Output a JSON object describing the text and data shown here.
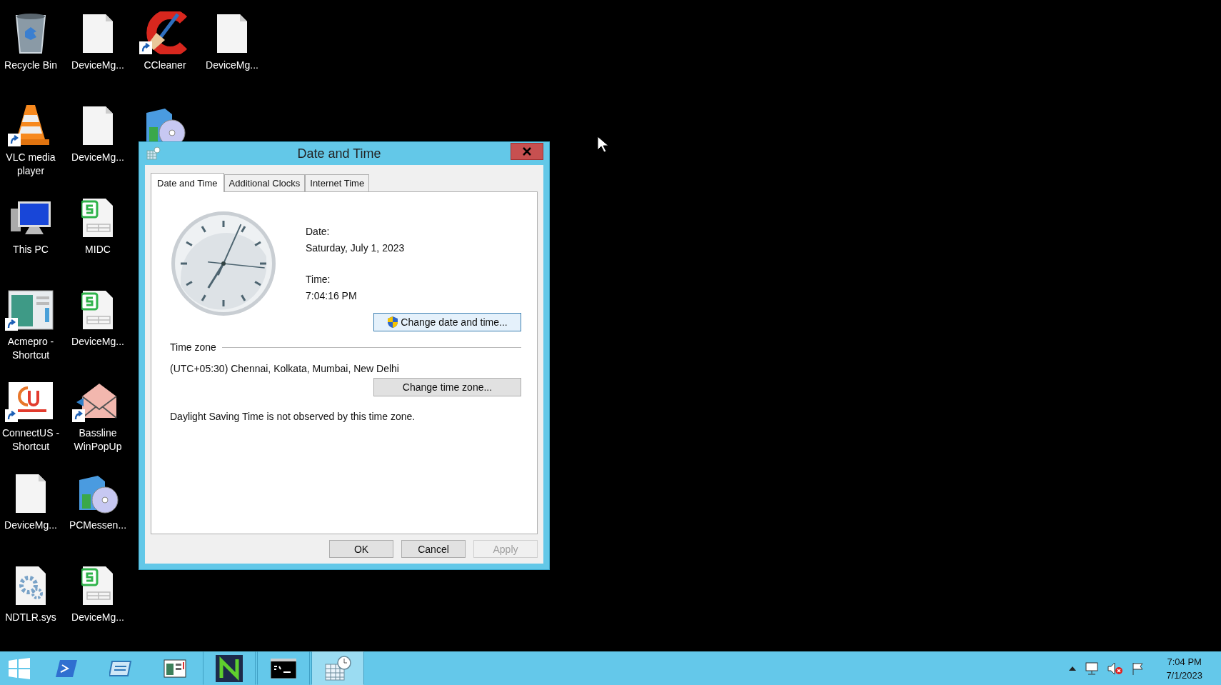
{
  "desktop": {
    "columns": [
      [
        {
          "label": "Recycle Bin",
          "kind": "recycle",
          "shortcut": false
        },
        {
          "label": "VLC media player",
          "kind": "cone",
          "shortcut": true
        },
        {
          "label": "This PC",
          "kind": "computer",
          "shortcut": false
        },
        {
          "label": "Acmepro - Shortcut",
          "kind": "window",
          "shortcut": true
        },
        {
          "label": "ConnectUS - Shortcut",
          "kind": "connect",
          "shortcut": true
        },
        {
          "label": "DeviceMg...",
          "kind": "file",
          "shortcut": false
        },
        {
          "label": "NDTLR.sys",
          "kind": "gear",
          "shortcut": false
        }
      ],
      [
        {
          "label": "DeviceMg...",
          "kind": "file",
          "shortcut": false
        },
        {
          "label": "DeviceMg...",
          "kind": "file",
          "shortcut": false
        },
        {
          "label": "MIDC",
          "kind": "sheet",
          "shortcut": false
        },
        {
          "label": "DeviceMg...",
          "kind": "sheet",
          "shortcut": false
        },
        {
          "label": "Bassline WinPopUp",
          "kind": "envelope",
          "shortcut": true
        },
        {
          "label": "PCMessen...",
          "kind": "installer",
          "shortcut": false
        },
        {
          "label": "DeviceMg...",
          "kind": "sheet",
          "shortcut": false
        }
      ],
      [
        {
          "label": "CCleaner",
          "kind": "broom",
          "shortcut": true
        },
        {
          "kind": "installer",
          "shortcut": false
        }
      ],
      [
        {
          "label": "DeviceMg...",
          "kind": "file",
          "shortcut": false
        }
      ]
    ]
  },
  "dialog": {
    "title": "Date and Time",
    "tabs": [
      {
        "label": "Date and Time",
        "selected": true
      },
      {
        "label": "Additional Clocks",
        "selected": false
      },
      {
        "label": "Internet Time",
        "selected": false
      }
    ],
    "date_label": "Date:",
    "date": "Saturday, July 1, 2023",
    "time_label": "Time:",
    "time": "7:04:16 PM",
    "change_datetime_button": "Change date and time...",
    "time_zone_heading": "Time zone",
    "time_zone": "(UTC+05:30) Chennai, Kolkata, Mumbai, New Delhi",
    "change_time_zone_button": "Change time zone...",
    "dst_note": "Daylight Saving Time is not observed by this time zone.",
    "buttons": [
      {
        "label": "OK",
        "disabled": false
      },
      {
        "label": "Cancel",
        "disabled": false
      },
      {
        "label": "Apply",
        "disabled": true
      }
    ]
  },
  "taskbar": {
    "items": [
      {
        "kind": "start",
        "running": false,
        "selected": false
      },
      {
        "kind": "shell",
        "running": false,
        "selected": false
      },
      {
        "kind": "folder",
        "running": false,
        "selected": false
      },
      {
        "kind": "server",
        "running": false,
        "selected": false
      },
      {
        "kind": "napp",
        "running": true,
        "selected": false
      },
      {
        "kind": "console",
        "running": true,
        "selected": false
      },
      {
        "kind": "calendar",
        "running": true,
        "selected": true
      }
    ],
    "tray": {
      "time": "7:04 PM",
      "date": "7/1/2023"
    }
  }
}
